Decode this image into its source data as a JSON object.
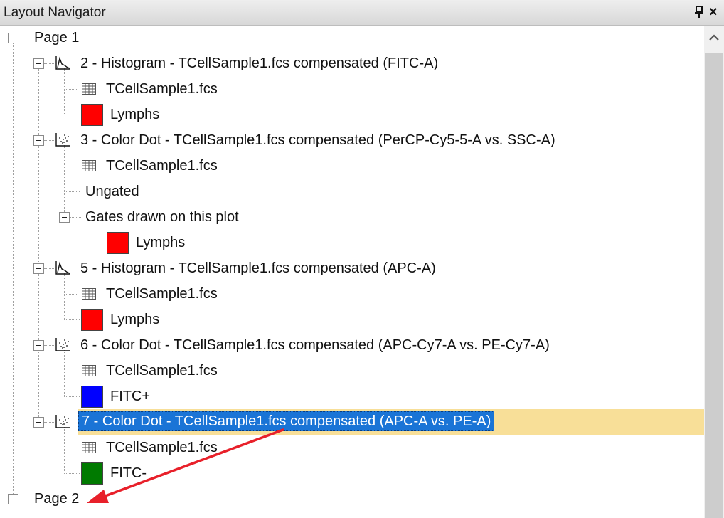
{
  "window": {
    "title": "Layout Navigator",
    "pin_glyph": "↕",
    "close_glyph": "×"
  },
  "colors": {
    "red": "#ff0000",
    "blue": "#0000ff",
    "green": "#007a00",
    "selection": "#1a74d6",
    "row_highlight": "#f8df98"
  },
  "tree": {
    "page1": "Page 1",
    "plot2": {
      "label": "2 - Histogram - TCellSample1.fcs compensated (FITC-A)",
      "file": "TCellSample1.fcs",
      "gate": "Lymphs"
    },
    "plot3": {
      "label": "3 - Color Dot - TCellSample1.fcs compensated (PerCP-Cy5-5-A vs. SSC-A)",
      "file": "TCellSample1.fcs",
      "ungated": "Ungated",
      "gates_folder": "Gates drawn on this plot",
      "gate": "Lymphs"
    },
    "plot5": {
      "label": "5 - Histogram - TCellSample1.fcs compensated (APC-A)",
      "file": "TCellSample1.fcs",
      "gate": "Lymphs"
    },
    "plot6": {
      "label": "6 - Color Dot - TCellSample1.fcs compensated (APC-Cy7-A vs. PE-Cy7-A)",
      "file": "TCellSample1.fcs",
      "gate": "FITC+"
    },
    "plot7": {
      "label": "7 - Color Dot - TCellSample1.fcs compensated (APC-A vs. PE-A)",
      "file": "TCellSample1.fcs",
      "gate": "FITC-"
    },
    "page2": "Page 2"
  }
}
